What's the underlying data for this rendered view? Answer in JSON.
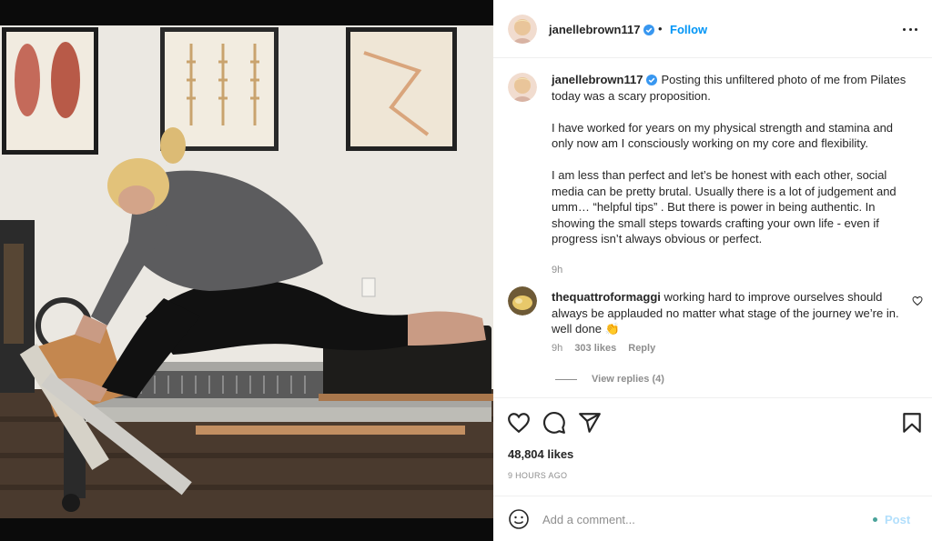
{
  "post": {
    "photo_alt": "Photo of a woman stretching on a Pilates reformer",
    "username": "janellebrown117",
    "verified": true,
    "separator": "•",
    "follow_label": "Follow",
    "more_icon": "more-options-icon",
    "brand_blue": "#0095f6"
  },
  "caption": {
    "username": "janellebrown117",
    "paragraphs": [
      "Posting this unfiltered photo of me from Pilates today was a scary proposition.",
      "I have worked for years on my physical strength and stamina and only now am I consciously working on my core and flexibility.",
      "I am less than perfect and let’s be honest with each other, social media can be pretty brutal. Usually there is a lot of judgement and umm… “helpful tips” . But there is power in being authentic. In showing the small steps towards crafting your own life - even if progress isn’t always obvious or perfect."
    ],
    "time": "9h"
  },
  "comments": [
    {
      "username": "thequattroformaggi",
      "text": "working hard to improve ourselves should always be applauded no matter what stage of the journey we’re in. well done 👏",
      "time": "9h",
      "likes": "303 likes",
      "reply_label": "Reply",
      "view_replies": "View replies (4)"
    }
  ],
  "actions": {
    "like_icon": "heart-icon",
    "comment_icon": "comment-icon",
    "share_icon": "share-icon",
    "save_icon": "bookmark-icon",
    "likes_count": "48,804 likes",
    "time_ago": "9 HOURS AGO"
  },
  "add_comment": {
    "placeholder": "Add a comment...",
    "post_label": "Post",
    "emoji_icon": "emoji-icon"
  }
}
